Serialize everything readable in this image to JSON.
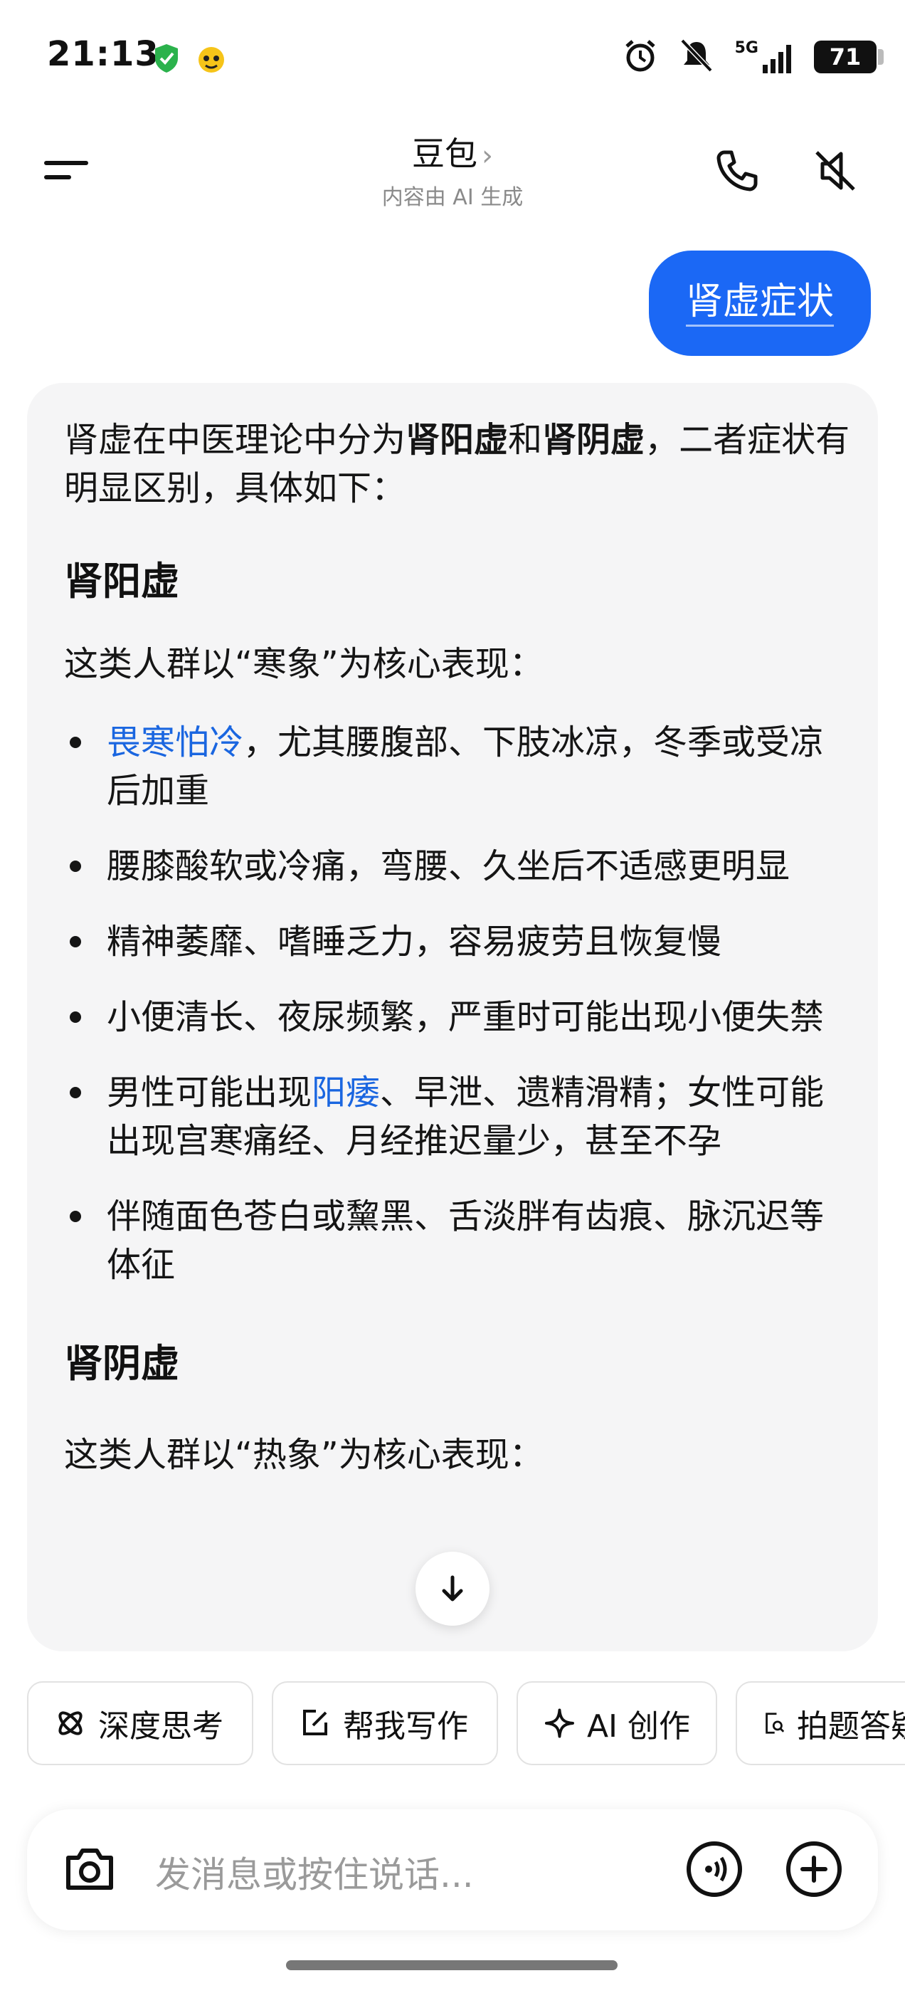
{
  "status_bar": {
    "time": "21:13",
    "network": "5G",
    "battery": "71"
  },
  "header": {
    "title": "豆包",
    "chevron": "›",
    "subtitle": "内容由 AI 生成"
  },
  "user_message": "肾虚症状",
  "answer": {
    "intro_pre": "肾虚在中医理论中分为",
    "intro_b1": "肾阳虚",
    "intro_mid": "和",
    "intro_b2": "肾阴虚",
    "intro_post": "，二者症状有明显区别，具体如下：",
    "section1_title": "肾阳虚",
    "section1_intro": "这类人群以“寒象”为核心表现：",
    "section1_items": [
      {
        "link": "畏寒怕冷",
        "text": "，尤其腰腹部、下肢冰凉，冬季或受凉后加重"
      },
      {
        "text": "腰膝酸软或冷痛，弯腰、久坐后不适感更明显"
      },
      {
        "text": "精神萎靡、嗜睡乏力，容易疲劳且恢复慢"
      },
      {
        "text": "小便清长、夜尿频繁，严重时可能出现小便失禁"
      },
      {
        "pre": "男性可能出现",
        "link": "阳痿",
        "text": "、早泄、遗精滑精；女性可能出现宫寒痛经、月经推迟量少，甚至不孕"
      },
      {
        "text": "伴随面色苍白或黧黑、舌淡胖有齿痕、脉沉迟等体征"
      }
    ],
    "section2_title": "肾阴虚",
    "section2_intro": "这类人群以“热象”为核心表现："
  },
  "chips": [
    {
      "icon": "atom-icon",
      "label": "深度思考"
    },
    {
      "icon": "edit-icon",
      "label": "帮我写作"
    },
    {
      "icon": "sparkle-icon",
      "label": "AI 创作"
    },
    {
      "icon": "doc-search-icon",
      "label": "拍题答疑"
    }
  ],
  "input": {
    "placeholder": "发消息或按住说话..."
  },
  "colors": {
    "accent": "#1b68f5",
    "link": "#1a66e0",
    "card_bg": "#f5f5f6"
  }
}
